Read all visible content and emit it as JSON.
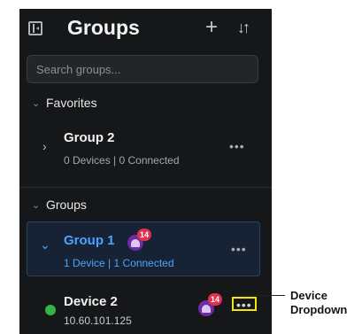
{
  "header": {
    "title": "Groups",
    "add_symbol": "+",
    "sort_symbol": "↓↑"
  },
  "search": {
    "placeholder": "Search groups..."
  },
  "favorites": {
    "label": "Favorites",
    "group": {
      "name": "Group 2",
      "subtitle": "0 Devices | 0 Connected"
    }
  },
  "groups": {
    "label": "Groups",
    "active_group": {
      "name": "Group 1",
      "alert_count": "14",
      "subtitle": "1 Device | 1 Connected"
    },
    "device": {
      "name": "Device 2",
      "ip": "10.60.101.125",
      "alert_count": "14"
    }
  },
  "annotation": {
    "line1": "Device",
    "line2": "Dropdown"
  },
  "colors": {
    "accent": "#4aa3ff",
    "status_connected": "#36b24a",
    "alert_badge": "#6f2aa5",
    "count_badge": "#e0314f",
    "highlight": "#f6e40c"
  },
  "icons": {
    "sidebar": "sidebar-toggle-icon",
    "add": "plus-icon",
    "sort": "sort-icon",
    "chevron": "chevron-icon",
    "more": "more-icon",
    "alert": "alert-bell-icon"
  },
  "more_symbol": "•••"
}
